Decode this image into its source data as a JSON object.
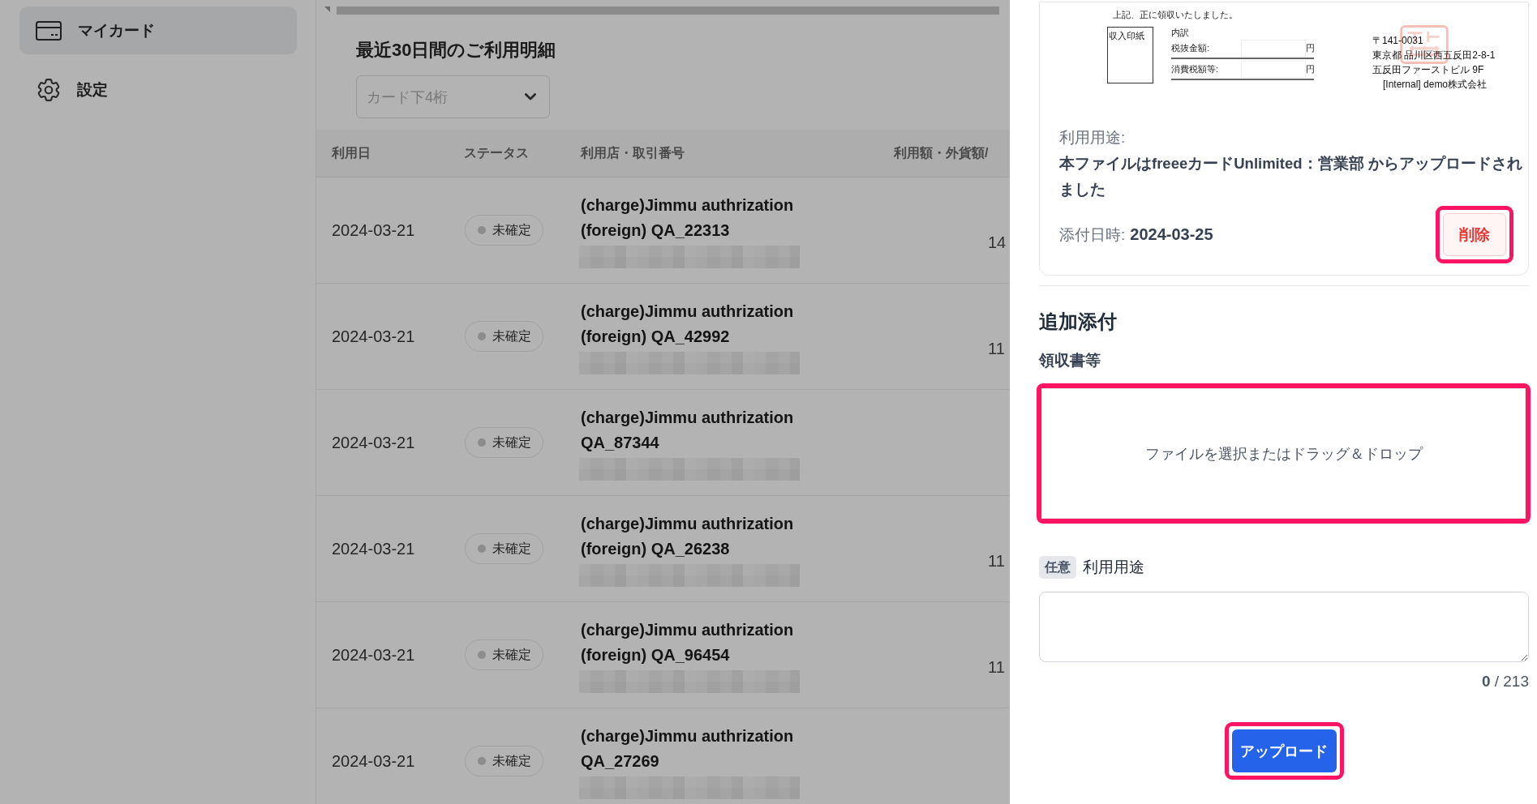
{
  "sidebar": {
    "items": [
      {
        "label": "マイカード",
        "selected": true
      },
      {
        "label": "設定",
        "selected": false
      }
    ]
  },
  "statement": {
    "title": "最近30日間のご利用明細",
    "card_filter": {
      "placeholder": "カード下4桁"
    },
    "table": {
      "columns": [
        "利用日",
        "ステータス",
        "利用店・取引番号",
        "利用額・外貨額/"
      ],
      "rows": [
        {
          "date": "2024-03-21",
          "status": "未確定",
          "merchant": "(charge)Jimmu authrization (foreign) QA_22313",
          "amount": "14"
        },
        {
          "date": "2024-03-21",
          "status": "未確定",
          "merchant": "(charge)Jimmu authrization (foreign) QA_42992",
          "amount": "11"
        },
        {
          "date": "2024-03-21",
          "status": "未確定",
          "merchant": "(charge)Jimmu authrization QA_87344"
        },
        {
          "date": "2024-03-21",
          "status": "未確定",
          "merchant": "(charge)Jimmu authrization (foreign) QA_26238",
          "amount": "11"
        },
        {
          "date": "2024-03-21",
          "status": "未確定",
          "merchant": "(charge)Jimmu authrization (foreign) QA_96454",
          "amount": "11"
        },
        {
          "date": "2024-03-21",
          "status": "未確定",
          "merchant": "(charge)Jimmu authrization QA_27269"
        }
      ]
    }
  },
  "attachment_panel": {
    "receipt": {
      "statement": "上記、正に領収いたしました。",
      "stamp_box": "収入印紙",
      "breakdown_title": "内訳",
      "breakdown": [
        {
          "label": "税抜金額:",
          "unit": "円"
        },
        {
          "label": "消費税額等:",
          "unit": "円"
        }
      ],
      "address": [
        "〒141-0031",
        "東京都 品川区西五反田2-8-1",
        "五反田ファーストビル 9F",
        "[Internal] demo株式会社"
      ]
    },
    "purpose_label": "利用用途:",
    "purpose_text": "**本ファイルはfreeeカードUnlimited**：営業部 からアップロードされました",
    "attached_label": "添付日時:",
    "attached_date": "2024-03-25",
    "delete_button": {
      "label": "削除",
      "highlighted": true
    },
    "additional": {
      "title": "追加添付",
      "receipt_label": "領収書等",
      "dropzone": {
        "text": "ファイルを選択またはドラッグ＆ドロップ",
        "highlighted": true
      },
      "optional_badge": "任意",
      "purpose_label": "利用用途",
      "counter": "**0** / 213",
      "upload_button": {
        "label": "アップロード",
        "highlighted": true
      }
    }
  }
}
